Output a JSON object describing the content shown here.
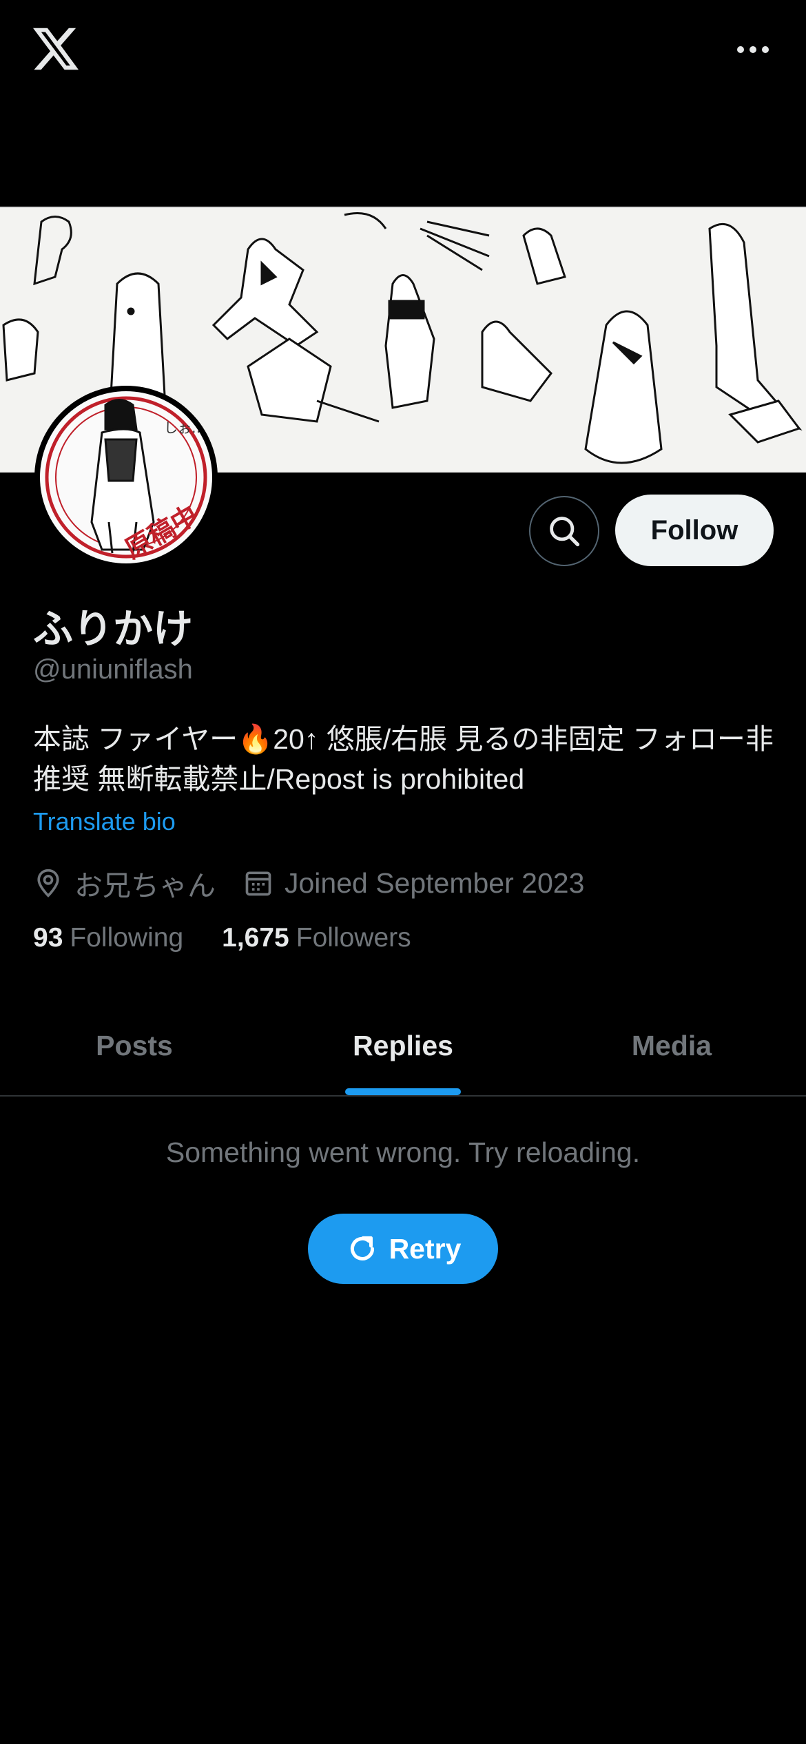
{
  "header": {
    "logo_icon": "x-logo-icon",
    "more_icon": "more-options-icon"
  },
  "profile": {
    "name": "ふりかけ",
    "handle": "@uniuniflash",
    "bio": "本誌 ファイヤー🔥20↑ 悠脹/右脹 見るの非固定 フォロー非推奨 無断転載禁止/Repost is prohibited",
    "translate_label": "Translate bio",
    "location": "お兄ちゃん",
    "joined": "Joined September 2023",
    "following_count": "93",
    "following_label": "Following",
    "followers_count": "1,675",
    "followers_label": "Followers",
    "avatar_stamp": "原稿中"
  },
  "actions": {
    "follow_label": "Follow",
    "search_icon": "search-icon"
  },
  "tabs": [
    {
      "label": "Posts",
      "active": false
    },
    {
      "label": "Replies",
      "active": true
    },
    {
      "label": "Media",
      "active": false
    }
  ],
  "error": {
    "message": "Something went wrong. Try reloading.",
    "retry_label": "Retry"
  },
  "colors": {
    "accent": "#1d9bf0",
    "background": "#000000",
    "muted": "#71767b"
  }
}
